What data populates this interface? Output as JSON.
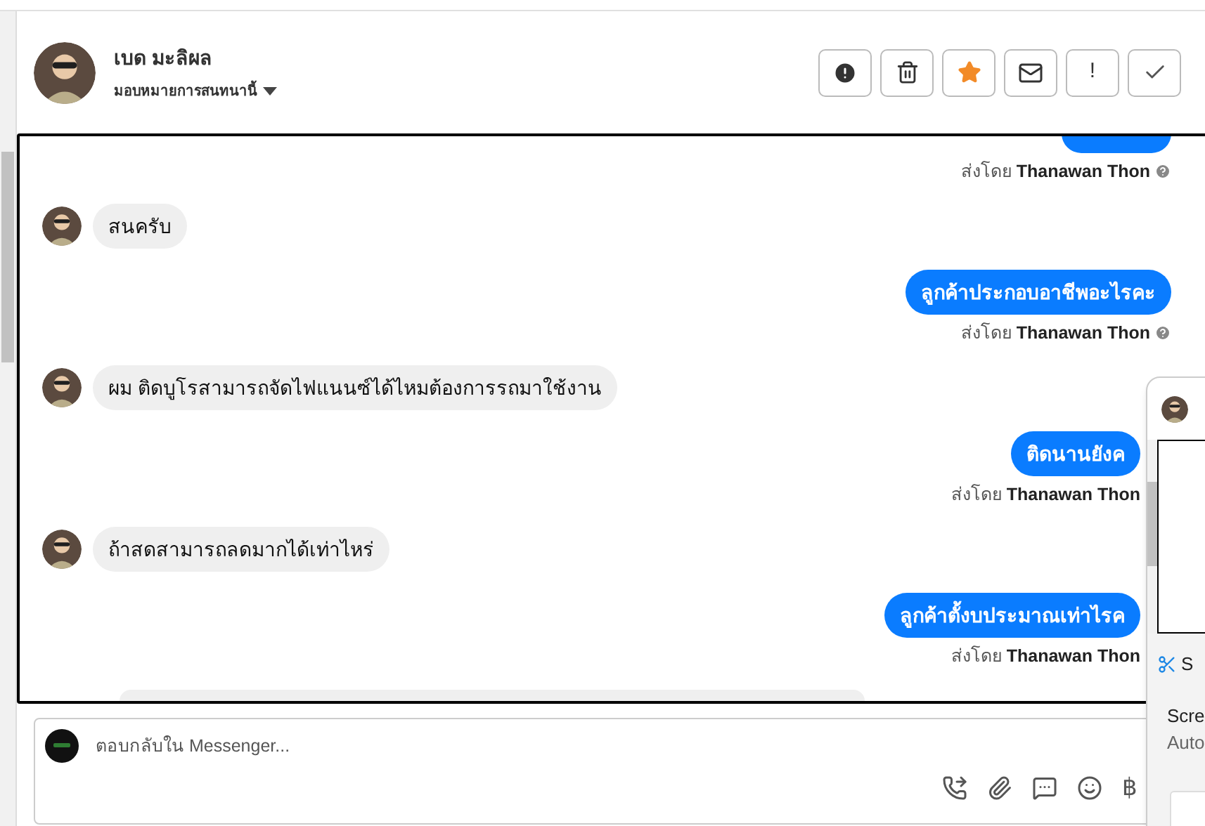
{
  "contact": {
    "name": "เบด มะลิผล",
    "assign_label": "มอบหมายการสนทนานี้"
  },
  "actions": [
    {
      "kind": "alert"
    },
    {
      "kind": "delete"
    },
    {
      "kind": "star"
    },
    {
      "kind": "mail"
    },
    {
      "kind": "text",
      "label": "!"
    },
    {
      "kind": "done"
    }
  ],
  "messages": [
    {
      "kind": "sent",
      "sent_by_label": "ส่งโดย",
      "sender": "Thanawan Thon",
      "info_icon": true
    },
    {
      "kind": "received",
      "text": "สนครับ"
    },
    {
      "kind": "sent",
      "text": "ลูกค้าประกอบอาชีพอะไรคะ",
      "sent_by_label": "ส่งโดย",
      "sender": "Thanawan Thon",
      "info_icon": true
    },
    {
      "kind": "received",
      "text": "ผม ติดบูโรสามารถจัดไฟแนนซ์ได้ไหมต้องการรถมาใช้งาน"
    },
    {
      "kind": "sent",
      "text": "ติดนานยังค",
      "sent_by_label": "ส่งโดย",
      "sender": "Thanawan Thon",
      "info_icon": false
    },
    {
      "kind": "received",
      "text": "ถ้าสดสามารถลดมากได้เท่าไหร่"
    },
    {
      "kind": "sent",
      "text": "ลูกค้าตั้งบประมาณเท่าไรค",
      "sent_by_label": "ส่งโดย",
      "sender": "Thanawan Thon",
      "info_icon": false
    },
    {
      "kind": "partial"
    }
  ],
  "composer": {
    "placeholder": "ตอบกลับใน Messenger...",
    "tools": [
      {
        "kind": "call"
      },
      {
        "kind": "attach"
      },
      {
        "kind": "reply"
      },
      {
        "kind": "emoji"
      },
      {
        "kind": "baht",
        "label": "฿"
      }
    ]
  },
  "overlay": {
    "snip_label": "S",
    "line_1": "Scre",
    "line_2": "Auto"
  }
}
